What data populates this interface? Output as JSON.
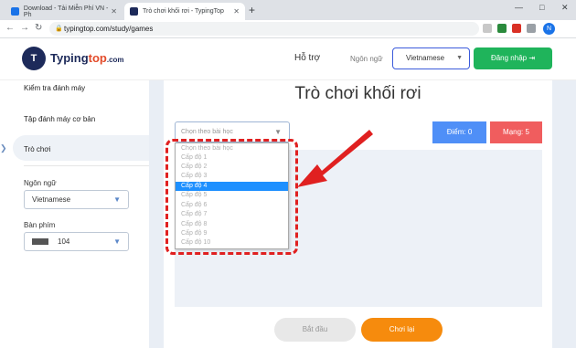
{
  "browser": {
    "tabs": [
      {
        "title": "Download - Tải Miễn Phí VN - Ph",
        "icon": "download-favicon"
      },
      {
        "title": "Trò chơi khối rơi - TypingTop",
        "icon": "typingtop-favicon"
      }
    ],
    "new_tab": "+",
    "url": "typingtop.com/study/games",
    "profile_initial": "N",
    "window_controls": [
      "—",
      "□",
      "✕"
    ]
  },
  "header": {
    "logo_text": "Typing",
    "logo_text_bold": "top",
    "logo_suffix": ".com",
    "help": "Hỗ trợ",
    "language_label": "Ngôn ngữ",
    "language_value": "Vietnamese",
    "login": "Đăng nhập"
  },
  "sidebar": {
    "items": [
      {
        "label": "Kiểm tra đánh máy"
      },
      {
        "label": "Tập đánh máy cơ bản"
      },
      {
        "label": "Trò chơi",
        "active": true
      }
    ],
    "language_label": "Ngôn ngữ",
    "language_value": "Vietnamese",
    "keyboard_label": "Bàn phím",
    "keyboard_value": "104"
  },
  "game": {
    "title": "Trò chơi khối rơi",
    "lesson_placeholder": "Chọn theo bài học",
    "score": "Điểm: 0",
    "lives": "Mạng: 5",
    "dropdown_options": [
      "Chọn theo bài học",
      "Cấp độ 1",
      "Cấp độ 2",
      "Cấp độ 3",
      "Cấp độ 4",
      "Cấp độ 5",
      "Cấp độ 6",
      "Cấp độ 7",
      "Cấp độ 8",
      "Cấp độ 9",
      "Cấp độ 10"
    ],
    "selected_option": "Cấp độ 4",
    "start": "Bắt đầu",
    "replay": "Chơi lại"
  },
  "colors": {
    "accent": "#1fb45b",
    "score_bg": "#4f8ff7",
    "lives_bg": "#f05d5e",
    "replay_bg": "#f68b0d",
    "highlight": "#e02020",
    "selected": "#1e90ff"
  }
}
